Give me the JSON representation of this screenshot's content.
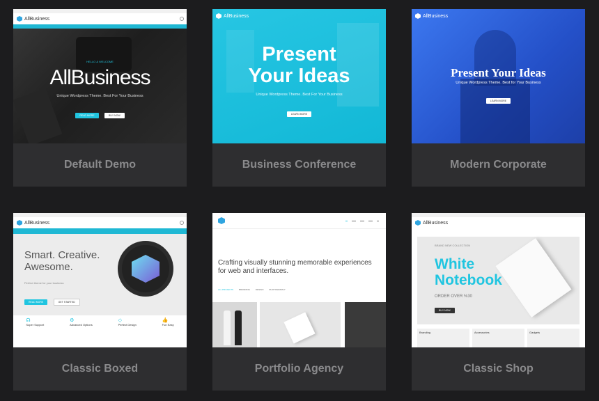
{
  "cards": [
    {
      "caption": "Default Demo",
      "hero": {
        "logo": "AllBusiness",
        "kicker": "HELLO & WELCOME",
        "title": "AllBusiness",
        "subtitle": "Unique Wordpress Theme. Best For Your Business",
        "btn1": "READ MORE",
        "btn2": "BUY NOW"
      }
    },
    {
      "caption": "Business Conference",
      "hero": {
        "logo": "AllBusiness",
        "title_line1": "Present",
        "title_line2": "Your Ideas",
        "subtitle": "Unique Wordpress Theme. Best For Your Business",
        "btn1": "LEARN MORE"
      }
    },
    {
      "caption": "Modern Corporate",
      "hero": {
        "logo": "AllBusiness",
        "title": "Present Your Ideas",
        "subtitle": "Unique Wordpress Theme. Best for Your Business",
        "btn1": "LEARN MORE"
      }
    },
    {
      "caption": "Classic Boxed",
      "hero": {
        "logo": "AllBusiness",
        "title_line1": "Smart. Creative.",
        "title_line2": "Awesome.",
        "subtitle": "Perfect theme for your business",
        "btn1": "READ MORE",
        "btn2": "GET STARTED",
        "features": [
          "Super Support",
          "Advanced Options",
          "Perfect Design",
          "Fun Easy"
        ]
      }
    },
    {
      "caption": "Portfolio Agency",
      "hero": {
        "text": "Crafting visually stunning memorable experiences for web and interfaces.",
        "filters": [
          "ALL PROJECTS",
          "BRANDING",
          "DESIGN",
          "PHOTOGRAPHY"
        ]
      }
    },
    {
      "caption": "Classic Shop",
      "hero": {
        "logo": "AllBusiness",
        "kicker": "BRAND NEW COLLECTION",
        "title_line1": "White",
        "title_line2": "Notebook",
        "subtitle": "ORDER OVER %30",
        "btn1": "BUY NOW",
        "categories": [
          "Branding",
          "Accessories",
          "Gadgets"
        ]
      }
    }
  ],
  "colors": {
    "accent": "#20c5e0",
    "blue": "#2b63d8",
    "dark": "#1c1c1e",
    "card": "#2e2e30"
  }
}
